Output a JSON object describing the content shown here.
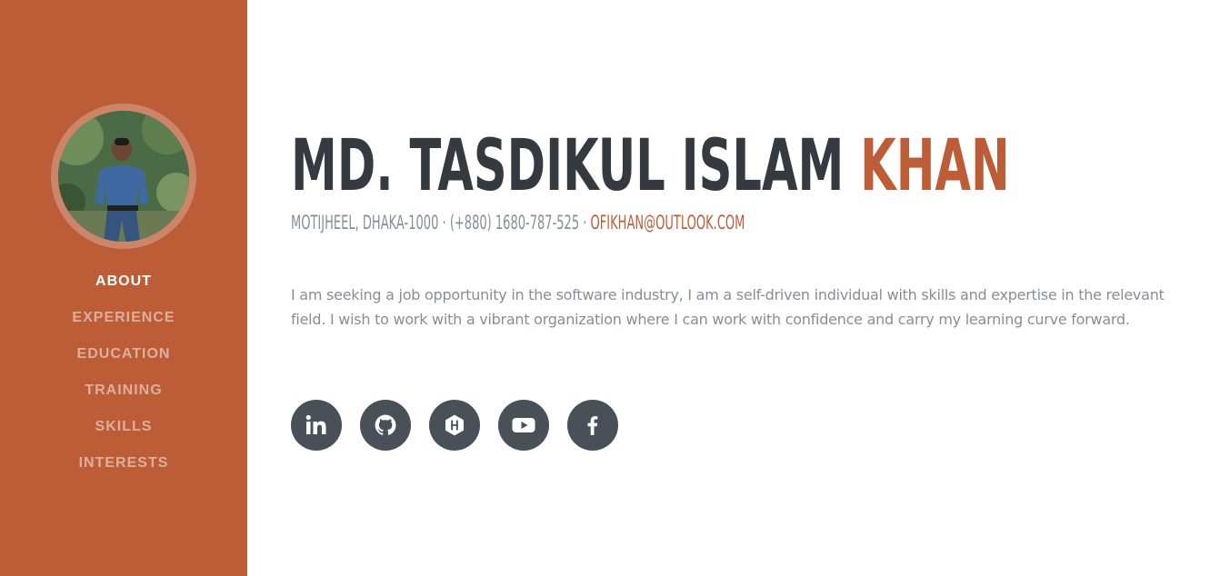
{
  "sidebar": {
    "avatar_alt": "Profile photo",
    "nav": [
      {
        "label": "About",
        "active": true
      },
      {
        "label": "Experience",
        "active": false
      },
      {
        "label": "Education",
        "active": false
      },
      {
        "label": "Training",
        "active": false
      },
      {
        "label": "Skills",
        "active": false
      },
      {
        "label": "Interests",
        "active": false
      }
    ]
  },
  "profile": {
    "first_name": "MD. TASDIKUL ISLAM",
    "last_name": "KHAN",
    "address": "MOTIJHEEL, DHAKA-1000",
    "separator": "·",
    "phone": "(+880) 1680-787-525",
    "email": "OFIKHAN@OUTLOOK.COM",
    "about": "I am seeking a job opportunity in the software industry, I am a self-driven individual with skills and expertise in the relevant field. I wish to work with a vibrant organization where I can work with confidence and carry my learning curve forward."
  },
  "social": [
    {
      "name": "linkedin-icon"
    },
    {
      "name": "github-icon"
    },
    {
      "name": "hackerrank-icon"
    },
    {
      "name": "youtube-icon"
    },
    {
      "name": "facebook-icon"
    }
  ],
  "colors": {
    "sidebar_bg": "#bd5d38",
    "accent": "#bd5d38",
    "heading": "#343a40",
    "muted_text": "#868e96",
    "social_bg": "#495057"
  }
}
